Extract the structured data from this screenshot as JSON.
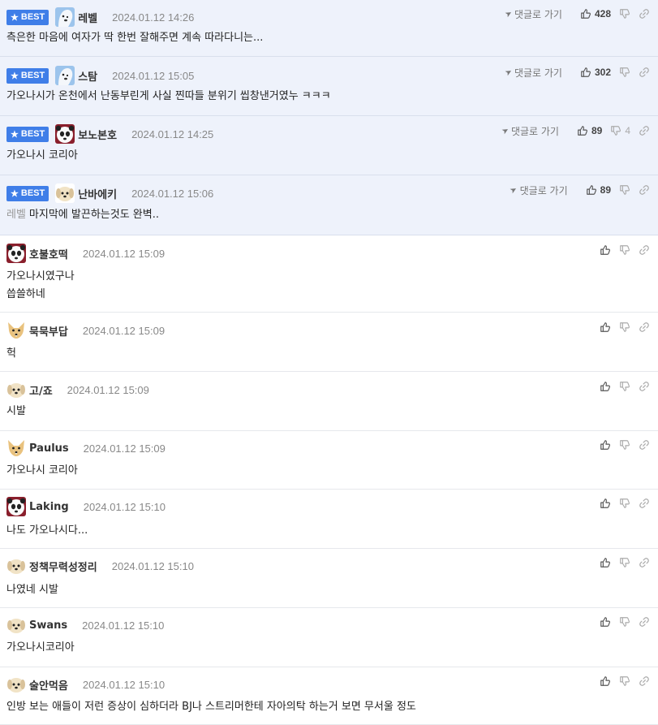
{
  "labels": {
    "best": "BEST",
    "goto": "댓글로 가기"
  },
  "colors": {
    "best_bg": "#eef2fb",
    "badge": "#3f7ee8"
  },
  "comments": [
    {
      "best": true,
      "avatar": "polar-bear",
      "nick": "레벨",
      "time": "2024.01.12 14:26",
      "likes": "428",
      "dislikes": "",
      "lines": [
        "측은한 마음에 여자가 딱 한번 잘해주면 계속 따라다니는..."
      ]
    },
    {
      "best": true,
      "avatar": "polar-bear",
      "nick": "스탐",
      "time": "2024.01.12 15:05",
      "likes": "302",
      "dislikes": "",
      "lines": [
        "가오나시가 온천에서 난동부린게 사실 찐따들 분위기 씹창낸거였누 ㅋㅋㅋ"
      ]
    },
    {
      "best": true,
      "avatar": "panda",
      "nick": "보노본호",
      "time": "2024.01.12 14:25",
      "likes": "89",
      "dislikes": "4",
      "lines": [
        "가오나시 코리아"
      ]
    },
    {
      "best": true,
      "avatar": "puppy",
      "nick": "난바에키",
      "time": "2024.01.12 15:06",
      "likes": "89",
      "dislikes": "",
      "mention": "레벨",
      "lines": [
        "마지막에 발끈하는것도 완벽.."
      ]
    },
    {
      "best": false,
      "avatar": "panda",
      "nick": "호불호떡",
      "time": "2024.01.12 15:09",
      "lines": [
        "가오나시였구나",
        "씁쓸하네"
      ]
    },
    {
      "best": false,
      "avatar": "fox",
      "nick": "묵묵부답",
      "time": "2024.01.12 15:09",
      "lines": [
        "헉"
      ]
    },
    {
      "best": false,
      "avatar": "puppy",
      "nick": "고/죠",
      "time": "2024.01.12 15:09",
      "lines": [
        "시발"
      ]
    },
    {
      "best": false,
      "avatar": "fox",
      "nick": "Paulus",
      "time": "2024.01.12 15:09",
      "lines": [
        "가오나시 코리아"
      ]
    },
    {
      "best": false,
      "avatar": "panda",
      "nick": "Laking",
      "time": "2024.01.12 15:10",
      "lines": [
        "나도 가오나시다..."
      ]
    },
    {
      "best": false,
      "avatar": "puppy",
      "nick": "정책무력성정리",
      "time": "2024.01.12 15:10",
      "lines": [
        "나였네 시발"
      ]
    },
    {
      "best": false,
      "avatar": "puppy",
      "nick": "Swans",
      "time": "2024.01.12 15:10",
      "lines": [
        "가오나시코리아"
      ]
    },
    {
      "best": false,
      "avatar": "puppy",
      "nick": "술안먹음",
      "time": "2024.01.12 15:10",
      "lines": [
        "인방 보는 애들이 저런 증상이 심하더라 BJ나 스트리머한테 자아의탁 하는거 보면 무서울 정도"
      ]
    }
  ]
}
